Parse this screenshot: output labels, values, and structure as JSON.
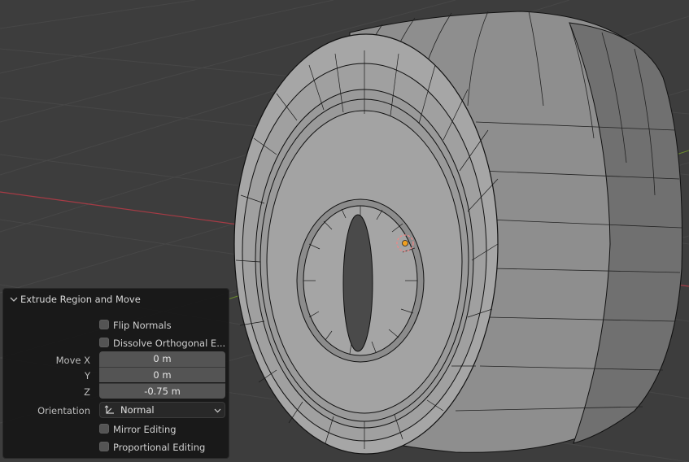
{
  "operator_panel": {
    "title": "Extrude Region and Move",
    "flip_normals_label": "Flip Normals",
    "flip_normals_checked": false,
    "dissolve_orthogonal_label": "Dissolve Orthogonal E...",
    "dissolve_orthogonal_checked": false,
    "move_x_label": "Move X",
    "move_x_value": "0 m",
    "move_y_label": "Y",
    "move_y_value": "0 m",
    "move_z_label": "Z",
    "move_z_value": "-0.75 m",
    "orientation_label": "Orientation",
    "orientation_value": "Normal",
    "mirror_editing_label": "Mirror Editing",
    "mirror_editing_checked": false,
    "proportional_editing_label": "Proportional Editing",
    "proportional_editing_checked": false
  },
  "viewport": {
    "background_color": "#3d3d3d",
    "grid_color": "#474747",
    "x_axis_color": "#a63b45",
    "y_axis_color": "#6a8a2e",
    "mesh_light_color": "#9f9f9f",
    "mesh_side_color": "#7a7a7a",
    "origin_marker": "object-origin-icon"
  }
}
